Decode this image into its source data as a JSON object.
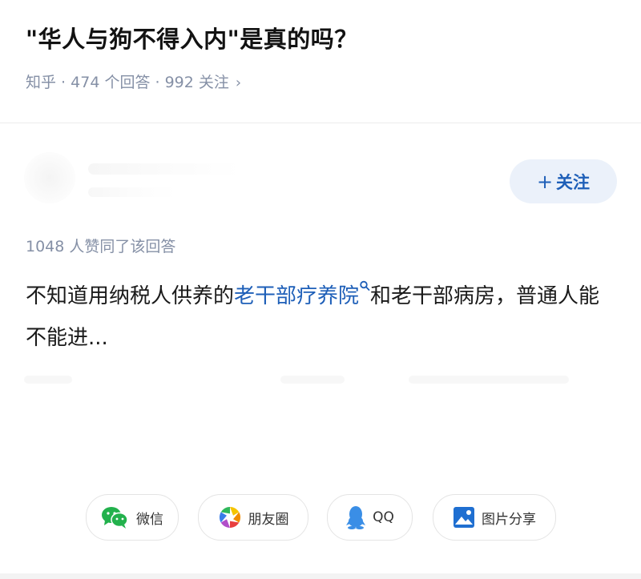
{
  "question": {
    "title": "\"华人与狗不得入内\"是真的吗？",
    "source": "知乎",
    "answers": "474 个回答",
    "followers": "992 关注"
  },
  "follow_button": {
    "plus": "+",
    "label": "关注"
  },
  "answer": {
    "vote_count": "1048 人赞同了该回答",
    "text_before": "不知道用纳税人供养的",
    "keyword": "老干部疗养院",
    "text_after": "和老干部病房，普通人能不能进..."
  },
  "share": {
    "wechat": "微信",
    "moments": "朋友圈",
    "qq": "QQ",
    "image": "图片分享"
  },
  "colors": {
    "link_blue": "#1e5fb8",
    "meta_gray": "#8590a6",
    "wechat_green": "#22b14c",
    "qq_blue": "#3a8ee6",
    "image_blue": "#1f6fd1"
  }
}
